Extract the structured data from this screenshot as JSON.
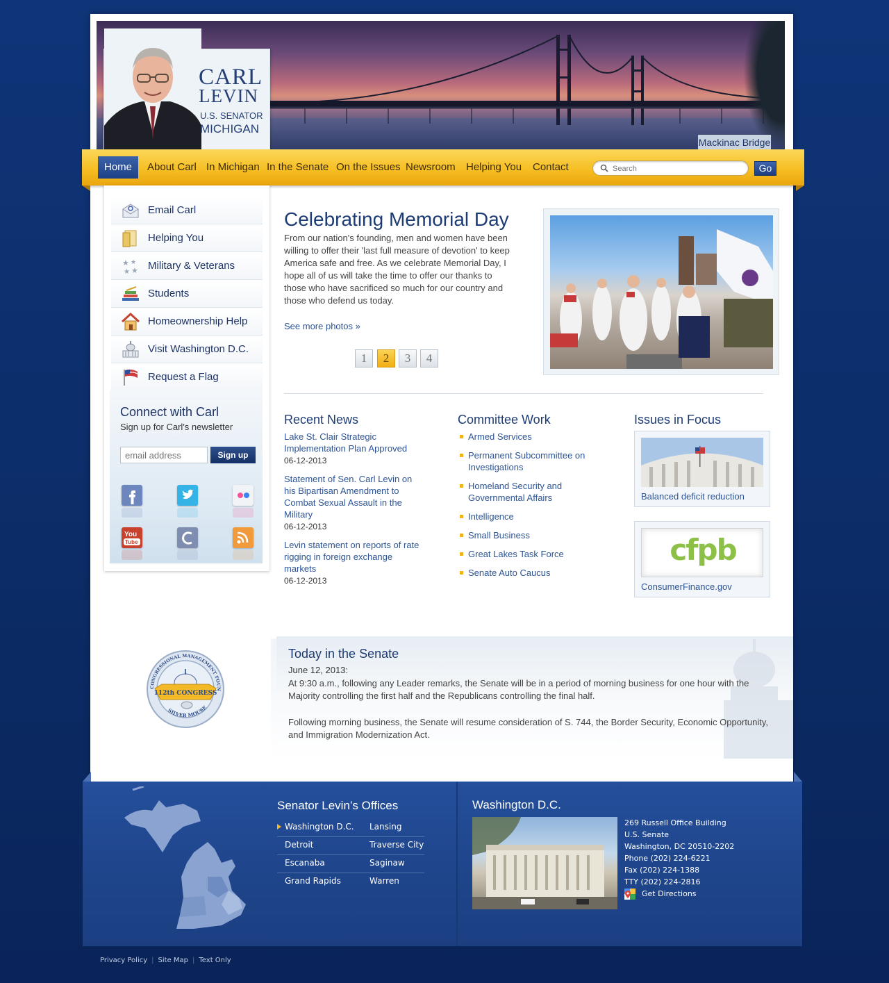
{
  "header": {
    "name_line1": "CARL",
    "name_line2": "LEVIN",
    "title_line1": "U.S. SENATOR",
    "title_line2": "MICHIGAN",
    "banner_caption": "Mackinac Bridge"
  },
  "nav": {
    "items": [
      "Home",
      "About Carl",
      "In Michigan",
      "In the Senate",
      "On the Issues",
      "Newsroom",
      "Helping You",
      "Contact"
    ],
    "active": "Home",
    "search_placeholder": "Search",
    "go_label": "Go"
  },
  "sidebar": {
    "items": [
      {
        "label": "Email Carl",
        "icon": "email-icon"
      },
      {
        "label": "Helping You",
        "icon": "folder-icon"
      },
      {
        "label": "Military & Veterans",
        "icon": "stars-icon"
      },
      {
        "label": "Students",
        "icon": "books-icon"
      },
      {
        "label": "Homeownership Help",
        "icon": "house-icon"
      },
      {
        "label": "Visit Washington D.C.",
        "icon": "capitol-icon"
      },
      {
        "label": "Request a Flag",
        "icon": "flag-icon"
      }
    ],
    "connect": {
      "title": "Connect with Carl",
      "subtitle": "Sign up for Carl's newsletter",
      "email_placeholder": "email address",
      "signup_label": "Sign up",
      "social": [
        "facebook-icon",
        "twitter-icon",
        "flickr-icon",
        "youtube-icon",
        "congress-c-icon",
        "rss-icon"
      ]
    }
  },
  "feature": {
    "title": "Celebrating Memorial Day",
    "text": "From our nation's founding, men and women  have been willing to offer their 'last full measure of devotion' to keep America safe and free. As we celebrate Memorial Day, I hope all of us will take the time to offer our thanks to those who have sacrificed so much for our country and those who defend us today.",
    "link": "See more photos  »",
    "pages": [
      "1",
      "2",
      "3",
      "4"
    ],
    "active_page": "2"
  },
  "recent_news": {
    "title": "Recent News",
    "items": [
      {
        "headline": "Lake St. Clair Strategic Implementation Plan Approved",
        "date": "06-12-2013"
      },
      {
        "headline": "Statement of Sen. Carl Levin on his Bipartisan Amendment to Combat Sexual Assault in the Military",
        "date": "06-12-2013"
      },
      {
        "headline": "Levin statement on reports of rate rigging in foreign exchange markets",
        "date": "06-12-2013"
      }
    ]
  },
  "committee_work": {
    "title": "Committee Work",
    "items": [
      "Armed Services",
      "Permanent Subcommittee on Investigations",
      "Homeland Security and Governmental Affairs",
      "Intelligence",
      "Small Business",
      "Great Lakes Task Force",
      "Senate Auto Caucus"
    ]
  },
  "issues_in_focus": {
    "title": "Issues in Focus",
    "cards": [
      {
        "caption": "Balanced deficit reduction",
        "image": "capitol-dome-photo"
      },
      {
        "caption": "ConsumerFinance.gov",
        "image": "cfpb-logo",
        "logo_text": "cfpb"
      }
    ]
  },
  "today_in_senate": {
    "title": "Today in the Senate",
    "date": "June 12, 2013:",
    "paragraph1": "At 9:30 a.m., following any Leader remarks, the Senate will be in a period of morning business for one hour with the Majority controlling the first half and the Republicans controlling the final half.",
    "paragraph2": "Following morning business, the Senate will resume consideration of S. 744, the Border Security, Economic Opportunity, and Immigration Modernization Act."
  },
  "award": {
    "ring_top": "CONGRESSIONAL MANAGEMENT FOUNDATION",
    "ribbon": "112th CONGRESS",
    "ring_bottom": "SILVER MOUSE"
  },
  "footer": {
    "offices_title": "Senator Levin’s Offices",
    "offices": [
      [
        "Washington D.C.",
        "Lansing"
      ],
      [
        "Detroit",
        "Traverse City"
      ],
      [
        "Escanaba",
        "Saginaw"
      ],
      [
        "Grand Rapids",
        "Warren"
      ]
    ],
    "selected_office": "Washington D.C.",
    "dc": {
      "title": "Washington D.C.",
      "lines": [
        "269 Russell Office Building",
        "U.S. Senate",
        "Washington, DC 20510-2202",
        "Phone (202) 224-6221",
        "Fax (202) 224-1388",
        "TTY (202) 224-2816"
      ],
      "directions": "Get Directions"
    },
    "links": [
      "Privacy Policy",
      "Site Map",
      "Text Only"
    ]
  },
  "colors": {
    "page_bg": "#0f3478",
    "nav_gold": "#f6bf24",
    "link_blue": "#2d5496",
    "heading_blue": "#1d3b74",
    "footer_blue": "#1e4489"
  }
}
